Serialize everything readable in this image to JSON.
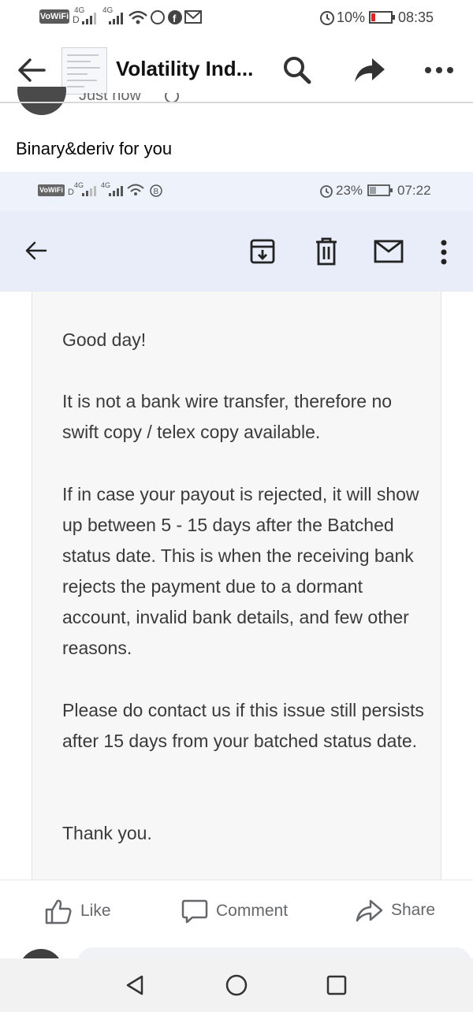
{
  "status_bar": {
    "vowifi": "VoWiFi",
    "net1": "4G",
    "net2": "4G",
    "battery": "10%",
    "time": "08:35"
  },
  "header": {
    "title": "Volatility Ind..."
  },
  "post": {
    "timestamp": "Just now",
    "text": "Binary&deriv for you"
  },
  "embedded": {
    "status_bar": {
      "vowifi": "VoWiFi",
      "net1": "4G",
      "net2": "4G",
      "battery": "23%",
      "time": "07:22"
    },
    "email": {
      "p1": "Good day!",
      "p2": "It is not a bank wire transfer, therefore no swift copy / telex copy available.",
      "p3": "If in case your payout is rejected, it will show up between 5 - 15 days after the Batched status date. This is when the receiving bank rejects the payment due to a dormant account, invalid bank details, and few other reasons.",
      "p4": "Please do contact us if this issue still persists after 15 days from your batched status date.",
      "p5": "Thank you."
    }
  },
  "actions": {
    "like": "Like",
    "comment": "Comment",
    "share": "Share"
  },
  "colors": {
    "facebook_gray": "#65676b",
    "embedded_toolbar": "#e8edf9",
    "battery_low": "#e02424"
  }
}
